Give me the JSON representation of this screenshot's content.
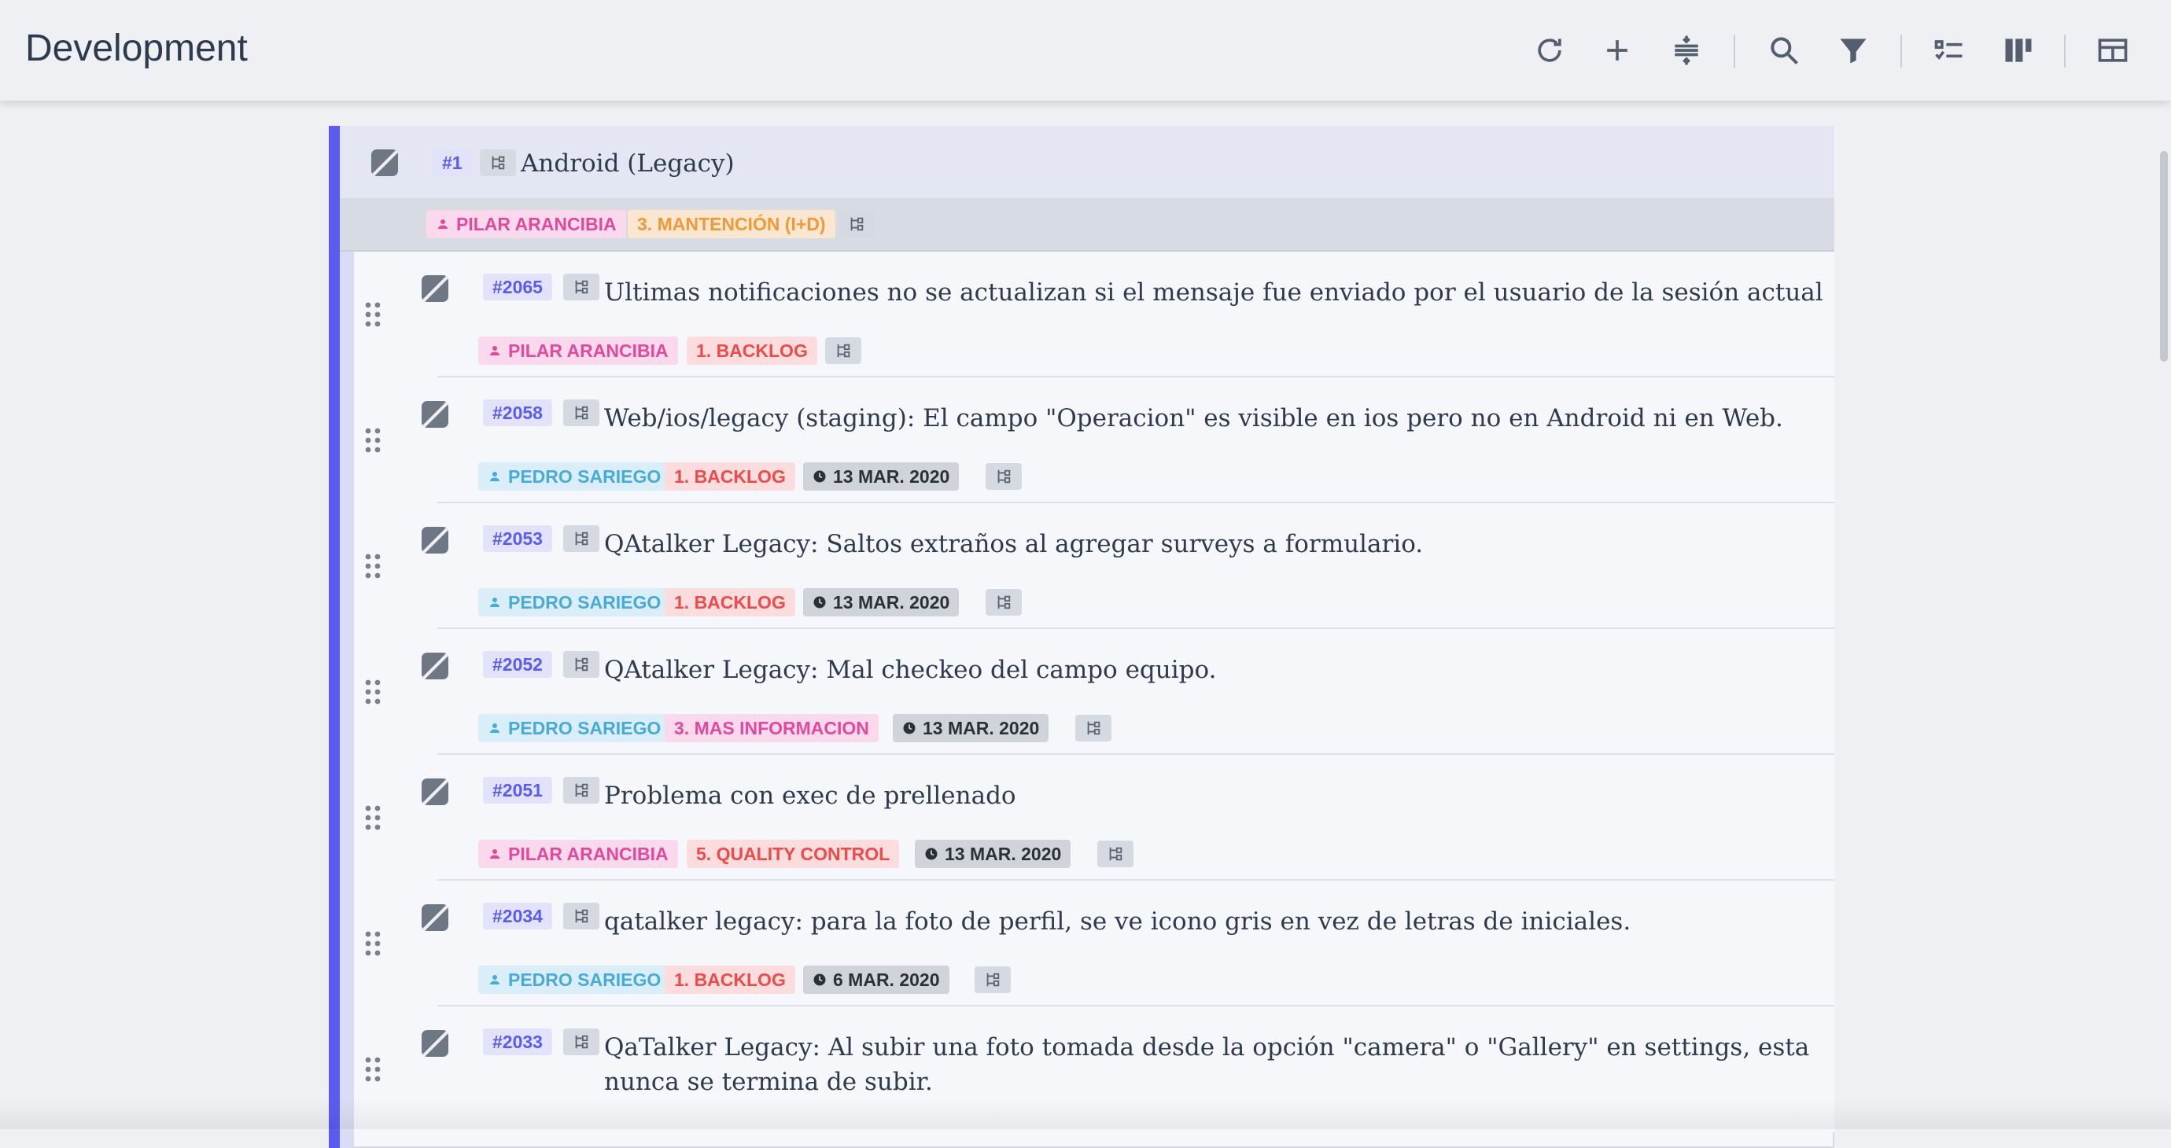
{
  "header": {
    "title": "Development",
    "toolbar": [
      {
        "name": "refresh-icon"
      },
      {
        "name": "add-icon"
      },
      {
        "name": "collapse-icon"
      },
      {
        "name": "search-icon"
      },
      {
        "name": "filter-icon"
      },
      {
        "name": "checklist-view-icon"
      },
      {
        "name": "kanban-view-icon"
      },
      {
        "name": "table-view-icon"
      }
    ]
  },
  "group": {
    "id": "#1",
    "title": "Android (Legacy)",
    "assignee": "PILAR ARANCIBIA",
    "status": "3. MANTENCIÓN (I+D)"
  },
  "rows": [
    {
      "id": "#2065",
      "title": "Ultimas notificaciones no se actualizan si el mensaje fue enviado por el usuario de la sesión actual",
      "title_line2": "",
      "assignee": "PILAR ARANCIBIA",
      "status": "1. BACKLOG",
      "date": ""
    },
    {
      "id": "#2058",
      "title": "Web/ios/legacy (staging): El campo \"Operacion\" es visible en ios pero no en Android ni en Web.",
      "title_line2": "",
      "assignee": "PEDRO SARIEGO",
      "status": "1. BACKLOG",
      "date": "13 MAR. 2020"
    },
    {
      "id": "#2053",
      "title": "QAtalker Legacy: Saltos extraños al agregar surveys a formulario.",
      "title_line2": "",
      "assignee": "PEDRO SARIEGO",
      "status": "1. BACKLOG",
      "date": "13 MAR. 2020"
    },
    {
      "id": "#2052",
      "title": "QAtalker Legacy: Mal checkeo del campo equipo.",
      "title_line2": "",
      "assignee": "PEDRO SARIEGO",
      "status": "3. MAS INFORMACION",
      "date": "13 MAR. 2020"
    },
    {
      "id": "#2051",
      "title": "Problema con exec de prellenado",
      "title_line2": "",
      "assignee": "PILAR ARANCIBIA",
      "status": "5. QUALITY CONTROL",
      "date": "13 MAR. 2020"
    },
    {
      "id": "#2034",
      "title": "qatalker legacy: para la foto de perfil, se ve icono gris en vez de letras de iniciales.",
      "title_line2": "",
      "assignee": "PEDRO SARIEGO",
      "status": "1. BACKLOG",
      "date": "6 MAR. 2020"
    },
    {
      "id": "#2033",
      "title": "QaTalker Legacy: Al subir una foto tomada desde la opción \"camera\" o \"Gallery\" en settings, esta",
      "title_line2": "nunca se termina de subir.",
      "assignee": "",
      "status": "",
      "date": ""
    }
  ]
}
